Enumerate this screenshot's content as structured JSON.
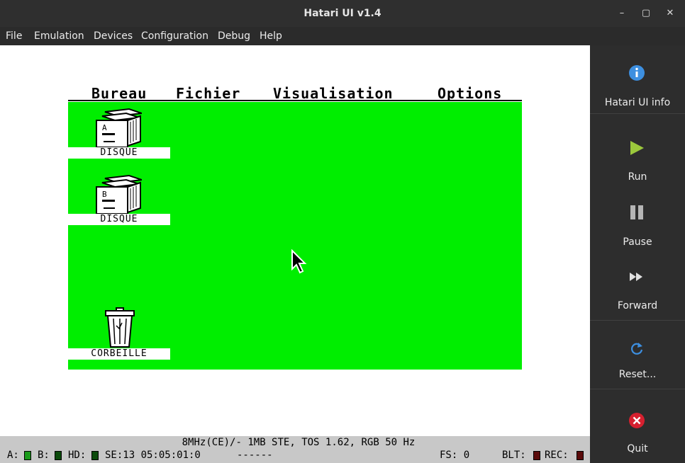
{
  "window": {
    "title": "Hatari UI v1.4",
    "controls": {
      "minimize": "–",
      "maximize": "▢",
      "close": "✕"
    }
  },
  "menubar": {
    "items": [
      "File",
      "Emulation",
      "Devices",
      "Configuration",
      "Debug",
      "Help"
    ]
  },
  "desktop": {
    "menus": [
      "Bureau",
      "Fichier",
      "Visualisation",
      "Options"
    ],
    "background_color": "#00ee00",
    "icons": [
      {
        "label": "DISQUE",
        "drive_letter": "A",
        "icon": "floppy-drive-icon"
      },
      {
        "label": "DISQUE",
        "drive_letter": "B",
        "icon": "floppy-drive-icon"
      },
      {
        "label": "CORBEILLE",
        "icon": "trash-can-icon"
      }
    ]
  },
  "status": {
    "line1": "8MHz(CE)/- 1MB STE, TOS 1.62, RGB 50 Hz",
    "drive_a": "A:",
    "drive_b": "B:",
    "hd": "HD:",
    "se": "SE:13 05:05:01:0",
    "dashes": "------",
    "fs": "FS: 0",
    "blt": "BLT:",
    "rec": "REC:",
    "led_colors": {
      "green": "#1a9a1a",
      "dark_green": "#0b4a0b",
      "dark_red": "#5a0a0a"
    }
  },
  "panel": {
    "buttons": [
      {
        "label": "Hatari UI info",
        "icon": "info-icon"
      },
      {
        "label": "Run",
        "icon": "play-icon"
      },
      {
        "label": "Pause",
        "icon": "pause-icon"
      },
      {
        "label": "Forward",
        "icon": "fast-forward-icon"
      },
      {
        "label": "Reset...",
        "icon": "reset-icon"
      },
      {
        "label": "Quit",
        "icon": "quit-icon"
      }
    ],
    "colors": {
      "info": "#3d8fe0",
      "play": "#9bc83c",
      "quit": "#d6202f"
    }
  }
}
